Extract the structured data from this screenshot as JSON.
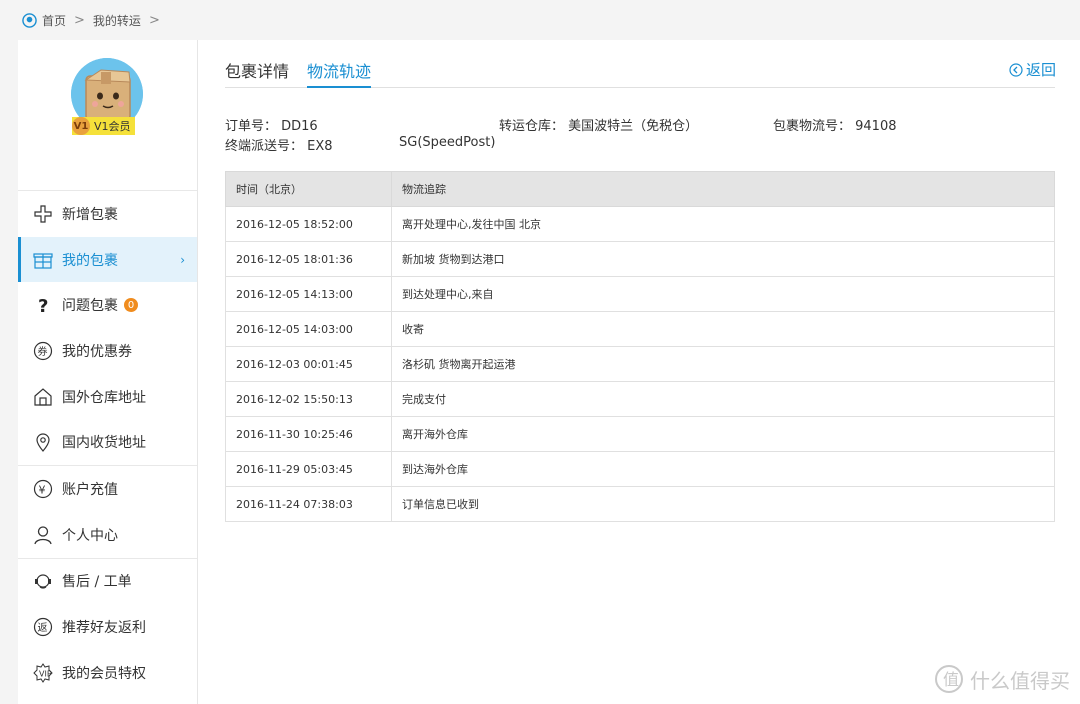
{
  "breadcrumb": {
    "home": "首页",
    "current": "我的转运"
  },
  "profile": {
    "level_badge": "V1",
    "level_text": "V1会员"
  },
  "menu": [
    {
      "icon": "plus-icon",
      "label": "新增包裹",
      "active": false,
      "count": null
    },
    {
      "icon": "gift-box-icon",
      "label": "我的包裹",
      "active": true,
      "count": null
    },
    {
      "icon": "question-icon",
      "label": "问题包裹",
      "active": false,
      "count": "0"
    },
    {
      "icon": "coupon-icon",
      "label": "我的优惠券",
      "active": false,
      "count": null
    },
    {
      "icon": "warehouse-icon",
      "label": "国外仓库地址",
      "active": false,
      "count": null
    },
    {
      "icon": "location-icon",
      "label": "国内收货地址",
      "active": false,
      "count": null
    },
    {
      "icon": "yuan-icon",
      "label": "账户充值",
      "active": false,
      "count": null
    },
    {
      "icon": "user-icon",
      "label": "个人中心",
      "active": false,
      "count": null
    },
    {
      "icon": "headset-icon",
      "label": "售后 / 工单",
      "active": false,
      "count": null
    },
    {
      "icon": "rebate-icon",
      "label": "推荐好友返利",
      "active": false,
      "count": null
    },
    {
      "icon": "member-privilege-icon",
      "label": "我的会员特权",
      "active": false,
      "count": null
    }
  ],
  "tabs": {
    "details": "包裹详情",
    "tracking": "物流轨迹"
  },
  "back_label": "返回",
  "info": {
    "order_no": "订单号： DD16",
    "warehouse": "转运仓库： 美国波特兰（免税仓）",
    "tracking_no": "包裹物流号： 94108",
    "final_delivery_label": "终端派送号： EX8",
    "final_delivery_carrier": "SG(SpeedPost)"
  },
  "table": {
    "headers": [
      "时间（北京）",
      "物流追踪"
    ],
    "rows": [
      [
        "2016-12-05 18:52:00",
        "离开处理中心,发往中国 北京"
      ],
      [
        "2016-12-05 18:01:36",
        "新加坡 货物到达港口"
      ],
      [
        "2016-12-05 14:13:00",
        "到达处理中心,来自"
      ],
      [
        "2016-12-05 14:03:00",
        "收寄"
      ],
      [
        "2016-12-03 00:01:45",
        "洛杉矶 货物离开起运港"
      ],
      [
        "2016-12-02 15:50:13",
        "完成支付"
      ],
      [
        "2016-11-30 10:25:46",
        "离开海外仓库"
      ],
      [
        "2016-11-29 05:03:45",
        "到达海外仓库"
      ],
      [
        "2016-11-24 07:38:03",
        "订单信息已收到"
      ]
    ]
  },
  "watermark": "什么值得买",
  "colors": {
    "accent": "#1a8fd2",
    "badge": "#f5e13a",
    "count": "#f08c1e"
  }
}
